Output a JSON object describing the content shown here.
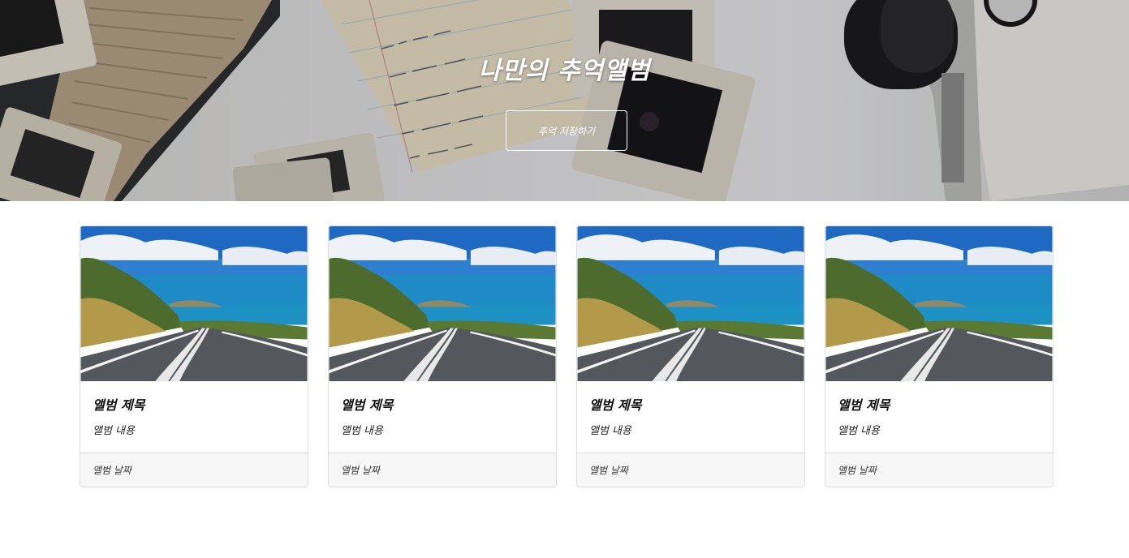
{
  "hero": {
    "title": "나만의 추억앨범",
    "button_label": "추억 저장하기"
  },
  "cards": [
    {
      "title": "앨범 제목",
      "text": "앨범 내용",
      "date": "앨범 날짜"
    },
    {
      "title": "앨범 제목",
      "text": "앨범 내용",
      "date": "앨범 날짜"
    },
    {
      "title": "앨범 제목",
      "text": "앨범 내용",
      "date": "앨범 날짜"
    },
    {
      "title": "앨범 제목",
      "text": "앨범 내용",
      "date": "앨범 날짜"
    }
  ],
  "colors": {
    "card_border": "#dcdcdc",
    "card_footer_bg": "#f7f7f7",
    "hero_text": "#ffffff"
  }
}
